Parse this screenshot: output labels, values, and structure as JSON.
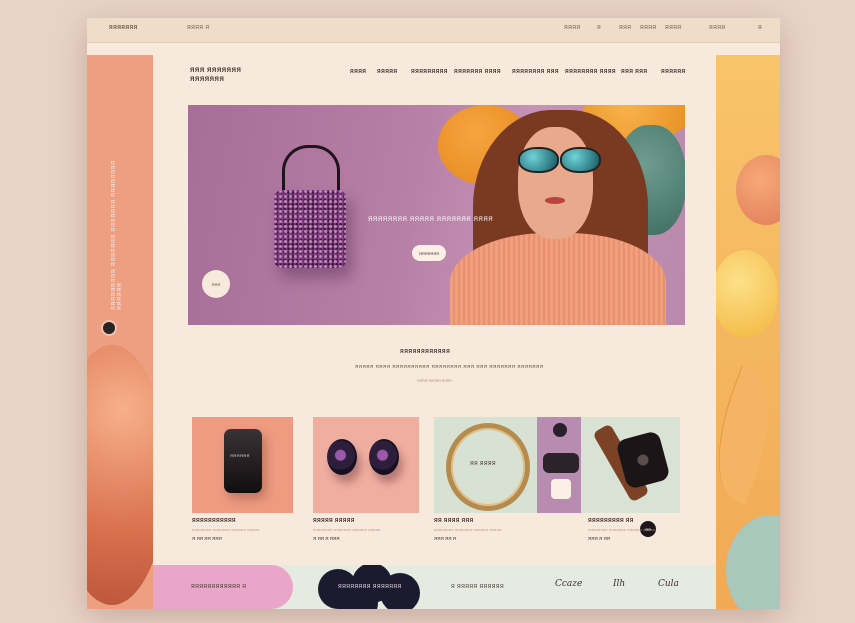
{
  "topbar": {
    "brand": "ЯЯЯЯЯЯЯ",
    "small": "ЯЯЯЯ  Я",
    "right_items": [
      "ЯЯЯЯ",
      "Я",
      "ЯЯЯ",
      "ЯЯЯЯ",
      "ЯЯЯЯ",
      "ЯЯЯЯ",
      "Я"
    ]
  },
  "logo": {
    "line1": "ЯЯЯ ЯЯЯЯЯЯЯ",
    "line2": "ЯЯЯЯЯЯЯ"
  },
  "nav": [
    "ЯЯЯЯ",
    "ЯЯЯЯЯ",
    "ЯЯЯЯЯЯЯЯЯ",
    "ЯЯЯЯЯЯЯ ЯЯЯЯ",
    "ЯЯЯЯЯЯЯЯ ЯЯЯ",
    "ЯЯЯЯЯЯЯЯ ЯЯЯЯ",
    "ЯЯЯ ЯЯЯ",
    "ЯЯЯЯЯЯ"
  ],
  "side_text": "ЯЯЯЯЯЯЯЯЯ ЯЯЯЯЯЯЯ ЯЯЯЯЯЯЯ ЯЯЯЯЯЯЯЯ ЯЯЯЯЯЯ",
  "hero": {
    "headline": "ЯЯЯЯЯЯЯЯ ЯЯЯЯЯ ЯЯЯЯЯЯЯ ЯЯЯЯ",
    "button": "ЯЯЯЯЯЯЯ",
    "circle": "ЯЯЯ"
  },
  "section": {
    "title": "ЯЯЯЯЯЯЯЯЯЯЯЯ",
    "subtitle": "ЯЯЯЯЯ ЯЯЯЯ ЯЯЯЯЯЯЯЯЯЯ ЯЯЯЯЯЯЯЯ ЯЯЯ ЯЯЯ ЯЯЯЯЯЯЯ ЯЯЯЯЯЯЯ",
    "tiny": "ЯЯЯЯ ЯЯЯЯЯ ЯЯЯЯ"
  },
  "products": [
    {
      "name": "ЯЯЯЯЯЯЯЯЯЯЯ",
      "meta": "ЯЯЯЯЯЯЯЯ ЯЯЯЯЯЯЯ ЯЯЯЯЯЯ ЯЯЯЯЯ",
      "price": "Я ЯЯ  ЯЯ ЯЯЯ",
      "image_text": "ЯЯЯЯЯЯ"
    },
    {
      "name": "ЯЯЯЯЯ ЯЯЯЯЯ",
      "meta": "ЯЯЯЯЯЯЯЯ ЯЯЯЯЯЯЯ ЯЯЯЯЯЯ ЯЯЯЯЯ",
      "price": "Я ЯЯ  Я ЯЯЯ"
    },
    {
      "name": "ЯЯ ЯЯЯЯ ЯЯЯ",
      "meta": "ЯЯЯЯЯЯЯЯ ЯЯЯЯЯЯЯ ЯЯЯЯЯЯ ЯЯЯЯЯ",
      "price": "ЯЯЯ  ЯЯ Я",
      "image_text": "ЯЯ ЯЯЯЯ"
    },
    {
      "name": "ЯЯЯЯЯЯЯЯЯ ЯЯ",
      "meta": "ЯЯЯЯЯЯЯЯ ЯЯЯЯЯЯЯ ЯЯЯЯЯЯ ЯЯЯЯЯ",
      "price": "ЯЯЯ  Я ЯЯ"
    }
  ],
  "cart_button": "ЯЯ",
  "footer": {
    "left": "ЯЯЯЯЯЯЯЯЯЯЯЯ  Я",
    "middle": "ЯЯЯЯЯЯЯЯ ЯЯЯЯЯЯЯ",
    "newsletter": "Я  ЯЯЯЯЯ ЯЯЯЯЯЯ",
    "scripts": [
      "Ccaze",
      "Ilh",
      "Cula"
    ]
  },
  "colors": {
    "left_panel": "#ee9f82",
    "right_panel": "#f8c46b",
    "hero_bg": "#b880a6",
    "page_bg": "#f7eadd",
    "footer_pink": "#e9a6c9"
  }
}
